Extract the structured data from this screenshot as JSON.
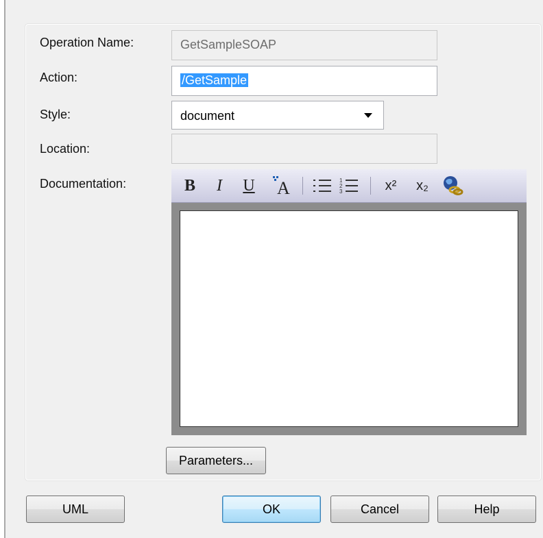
{
  "form": {
    "operation_name_label": "Operation Name:",
    "operation_name_value": "GetSampleSOAP",
    "action_label": "Action:",
    "action_value": "/GetSample",
    "style_label": "Style:",
    "style_value": "document",
    "location_label": "Location:",
    "location_value": "",
    "documentation_label": "Documentation:"
  },
  "editor_toolbar": {
    "bold": "B",
    "italic": "I",
    "underline": "U",
    "font_color": "A",
    "superscript": "x²",
    "subscript": "x₂",
    "icons": [
      "bold-icon",
      "italic-icon",
      "underline-icon",
      "font-color-icon",
      "bullet-list-icon",
      "numbered-list-icon",
      "superscript-icon",
      "subscript-icon",
      "hyperlink-icon"
    ]
  },
  "documentation_text": "",
  "buttons": {
    "parameters": "Parameters...",
    "uml": "UML",
    "ok": "OK",
    "cancel": "Cancel",
    "help": "Help"
  },
  "colors": {
    "selection": "#3399ff",
    "toolbar": "#cacae0",
    "default_button": "#bee6fd"
  }
}
